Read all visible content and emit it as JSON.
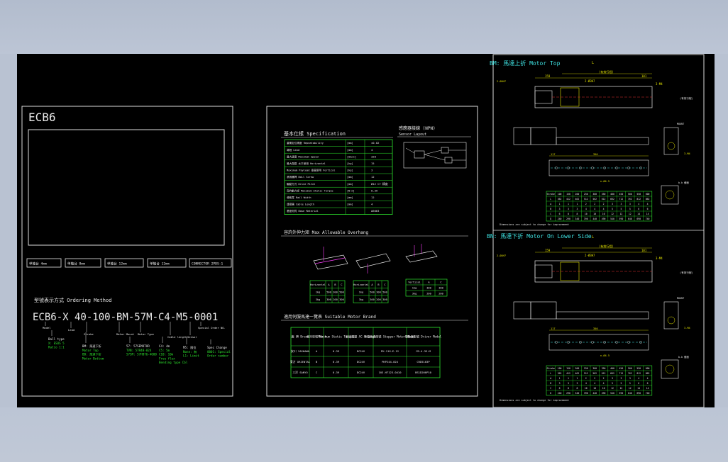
{
  "sheet1": {
    "title": "ECB6",
    "buttons": [
      "单轴台 4mm",
      "单轴台 8mm",
      "单轴台 12mm",
      "单轴台 12mm",
      "CONNECTOR 2PDS-1"
    ],
    "ordering_heading": "型號表示方式 Ordering Method",
    "model_code": "ECB6-X 40-100-BM-57M-C4-M5-0001",
    "code_labels": [
      "Model",
      "Lead",
      "Stroke",
      "Motor Mount",
      "Motor Type",
      "Cable length",
      "Sensor",
      "Special Order NO."
    ],
    "option_groups": [
      [
        "Ball type",
        "X: ESOS 5",
        "Ratio 1:1"
      ],
      [
        "BM: 馬達下折",
        "Motor Top",
        "BB: 馬達下折",
        "Motor Bottom"
      ],
      [
        "57: 57SEMOTOR",
        "TVN: 57R4B-024",
        "57SM: 57HB76-4000"
      ],
      [
        "C4: 4m",
        "C5: 5m",
        "C10: 10m",
        "Free flex",
        "Bending type Cbl"
      ],
      [
        "M5: 限位",
        "None: 無",
        "L1: Limit"
      ],
      [
        "Spec Change",
        "0001: Special",
        "Order number"
      ]
    ]
  },
  "sheet2": {
    "spec_heading": "基本仕樣 Specification",
    "spec_rows": [
      {
        "label": "重覆定位精度 Repeatability",
        "unit": "[mm]",
        "value": "±0.02"
      },
      {
        "label": "導程 Lead",
        "unit": "[mm]",
        "value": "4"
      },
      {
        "label": "最大速度 Maximum Speed",
        "unit": "[mm/s]",
        "value": "320"
      },
      {
        "label": "最大負載 水平使用 Horizontal",
        "unit": "[kg]",
        "value": "15"
      },
      {
        "label": "Maximum Payload 垂直使用 Vertical",
        "unit": "[kg]",
        "value": "3"
      },
      {
        "label": "滾珠螺桿 Ball Screw",
        "unit": "[mm]",
        "value": "12"
      },
      {
        "label": "驅動方式 Drive Pitch",
        "unit": "[mm]",
        "value": "Ø12 C7 精度"
      },
      {
        "label": "容許動力矩 Maximum Static Torque",
        "unit": "[N·m]",
        "value": "0.39"
      },
      {
        "label": "導軌寬 Rail Width",
        "unit": "[mm]",
        "value": "12"
      },
      {
        "label": "連接器 Cable Length",
        "unit": "[mm]",
        "value": "4"
      },
      {
        "label": "基座材質 Base Material",
        "unit": "",
        "value": "A6063"
      }
    ],
    "sensor_heading": "感應器接線 (NPN)",
    "sensor_subheading": "Sensor Layout",
    "overhang_heading": "容許外伸力矩 Max Allowable Overhang",
    "overhang_rows": [
      [
        "Horizontal",
        "A",
        "B",
        "C"
      ],
      [
        "1kg",
        "500",
        "300",
        "500"
      ],
      [
        "3kg",
        "300",
        "200",
        "300"
      ]
    ],
    "overhang_rows2": [
      [
        "Horizontal",
        "A",
        "B",
        "C"
      ],
      [
        "1kg",
        "500",
        "300",
        "500"
      ],
      [
        "3kg",
        "300",
        "200",
        "300"
      ]
    ],
    "overhang_vertical": [
      [
        "Vertical",
        "A",
        "C"
      ],
      [
        "1kg",
        "300",
        "300"
      ],
      [
        "3kg",
        "200",
        "200"
      ]
    ],
    "motor_heading": "適用伺服馬達一覽表 Suitable Motor Brand",
    "motor_headers": [
      "廠 牌 Brand",
      "系列型號 Mark",
      "Maximum Static Torque",
      "額定電壓 AC-Voltage",
      "步進馬達型號 Stepper Motor Model",
      "驅動器型號 Driver Model"
    ],
    "motor_rows": [
      [
        "安川 YASKAWA",
        "A",
        "0.39",
        "DC24V",
        "PK-11G-E-12",
        "CD-4-3S-M"
      ],
      [
        "東方 ORIENTAL",
        "B",
        "0.39",
        "DC24V",
        "PKP244-024",
        "CRD5103P"
      ],
      [
        "三洋 SANYO",
        "C",
        "0.39",
        "DC24V",
        "103-H7123-0410",
        "BS1D200P10"
      ]
    ]
  },
  "sheet3": {
    "top_heading": "BM: 馬達上折 Motor Top",
    "bottom_heading": "BN: 馬達下折 Motor On Lower Side",
    "dims": [
      "L",
      "159",
      "101",
      "350",
      "140",
      "21",
      "(有效行程)",
      "Stroke",
      "2-Ø3H7",
      "3-M4"
    ],
    "table_headers": [
      "Stroke",
      "100",
      "150",
      "200",
      "250",
      "300",
      "350",
      "400",
      "450",
      "500",
      "550",
      "600"
    ],
    "table_rows": [
      [
        "L",
        "362",
        "412",
        "462",
        "512",
        "562",
        "612",
        "662",
        "712",
        "762",
        "812",
        "862"
      ],
      [
        "A",
        "1",
        "1",
        "1",
        "2",
        "2",
        "2",
        "3",
        "3",
        "3",
        "4",
        "4"
      ],
      [
        "B",
        "3",
        "3",
        "3",
        "4",
        "4",
        "4",
        "5",
        "5",
        "5",
        "6",
        "6"
      ],
      [
        "C",
        "6",
        "8",
        "8",
        "10",
        "10",
        "10",
        "12",
        "12",
        "12",
        "14",
        "14"
      ],
      [
        "D",
        "240",
        "290",
        "340",
        "390",
        "440",
        "490",
        "540",
        "590",
        "640",
        "690",
        "740"
      ]
    ],
    "note": "Dimensions are subject to change for improvement"
  }
}
